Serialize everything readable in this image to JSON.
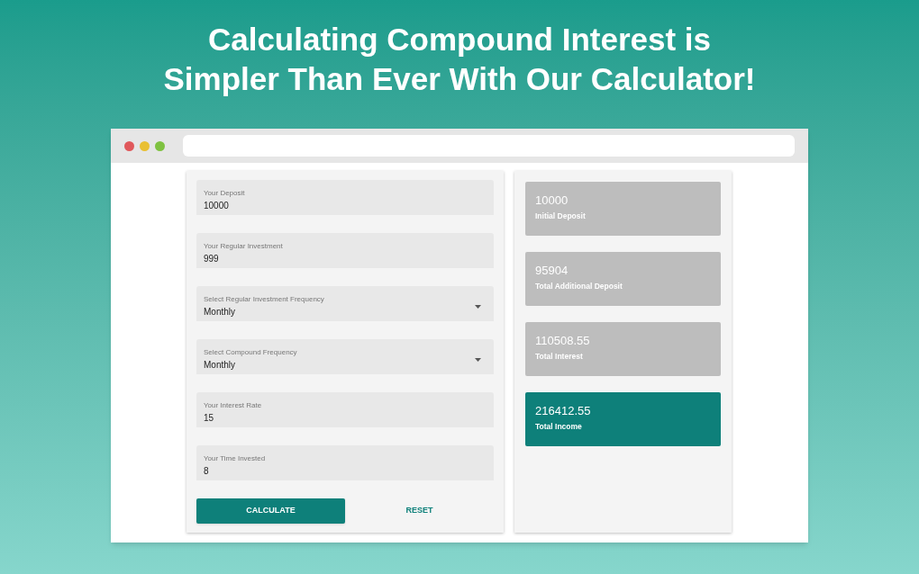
{
  "headline": [
    "Calculating Compound Interest is",
    "Simpler Than Ever With Our Calculator!"
  ],
  "browser": {
    "window_controls": [
      {
        "color": "#e0585b"
      },
      {
        "color": "#e9c033"
      },
      {
        "color": "#7fc241"
      }
    ]
  },
  "form": {
    "fields": [
      {
        "kind": "text",
        "label": "Your Deposit",
        "value": "10000"
      },
      {
        "kind": "text",
        "label": "Your Regular Investment",
        "value": "999"
      },
      {
        "kind": "select",
        "label": "Select Regular Investment Frequency",
        "value": "Monthly"
      },
      {
        "kind": "select",
        "label": "Select Compound Frequency",
        "value": "Monthly"
      },
      {
        "kind": "text",
        "label": "Your Interest Rate",
        "value": "15"
      },
      {
        "kind": "text",
        "label": "Your Time Invested",
        "value": "8"
      }
    ],
    "buttons": [
      {
        "kind": "primary",
        "label": "CALCULATE"
      },
      {
        "kind": "text",
        "label": "RESET"
      }
    ]
  },
  "results": [
    {
      "value": "10000",
      "label": "Initial Deposit",
      "highlighted": false
    },
    {
      "value": "95904",
      "label": "Total Additional Deposit",
      "highlighted": false
    },
    {
      "value": "110508.55",
      "label": "Total Interest",
      "highlighted": false
    },
    {
      "value": "216412.55",
      "label": "Total Income",
      "highlighted": true
    }
  ]
}
